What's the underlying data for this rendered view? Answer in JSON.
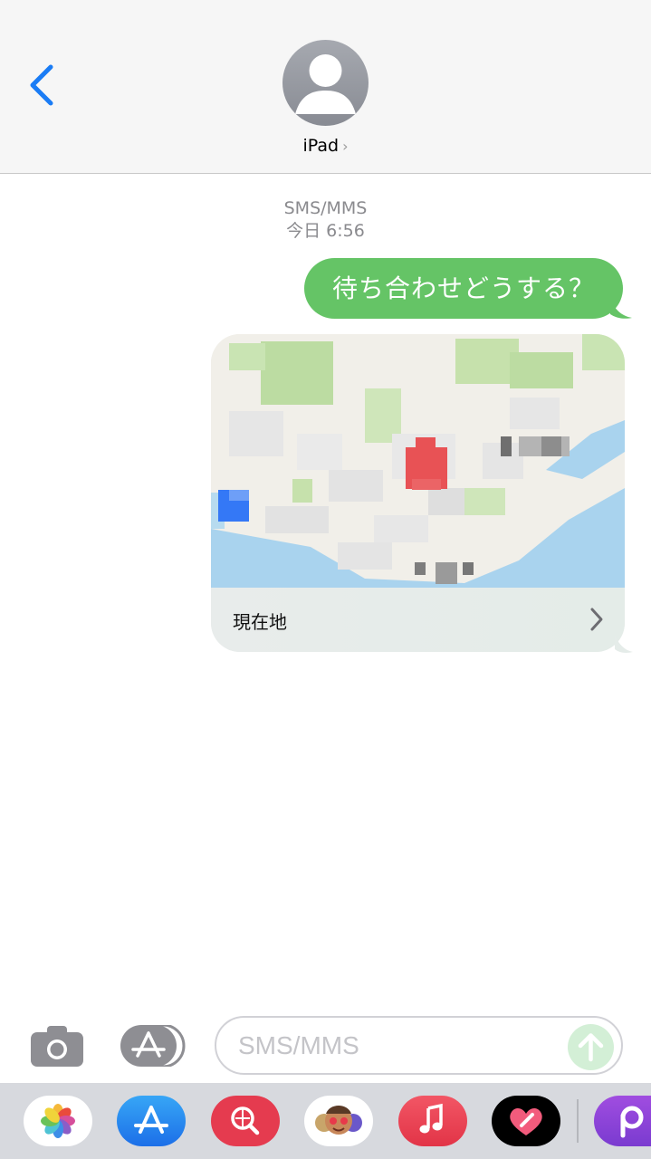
{
  "header": {
    "contact_name": "iPad",
    "contact_chevron": "›",
    "back_icon": "chevron-left-icon",
    "avatar_icon": "person-icon"
  },
  "conversation": {
    "service_label": "SMS/MMS",
    "timestamp": "今日 6:56",
    "messages": [
      {
        "type": "text",
        "text": "待ち合わせどうする？"
      },
      {
        "type": "location",
        "label": "現在地"
      }
    ]
  },
  "composer": {
    "placeholder": "SMS/MMS",
    "value": "",
    "camera_icon": "camera-icon",
    "apps_icon": "app-store-icon",
    "send_icon": "arrow-up-icon"
  },
  "dock": {
    "apps": [
      "photos-icon",
      "app-store-icon",
      "web-search-icon",
      "memoji-icon",
      "music-icon",
      "digital-touch-icon",
      "purple-p-app-icon"
    ]
  },
  "colors": {
    "accent": "#1a7cf5",
    "bubble_green": "#65c466",
    "meta_gray": "#8a8a8e",
    "map_pin": "#e85255"
  }
}
